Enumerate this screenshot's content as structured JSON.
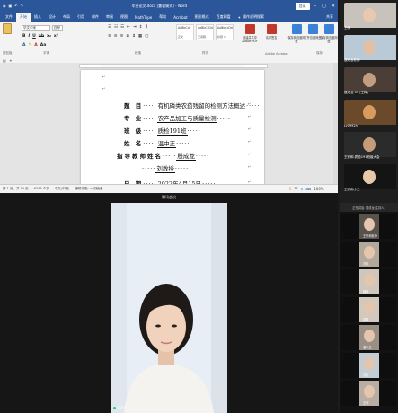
{
  "word": {
    "title": "毕业论文.docx [兼容模式] - Word",
    "login_label": "登录",
    "tabs": [
      "文件",
      "开始",
      "插入",
      "设计",
      "布局",
      "引用",
      "邮件",
      "审阅",
      "视图",
      "MathType",
      "帮助",
      "Acrobat",
      "图形格式",
      "百度网盘"
    ],
    "active_tab": "开始",
    "tell_me": "操作说明搜索",
    "share": "共享",
    "ribbon": {
      "clipboard_label": "剪贴板",
      "paste_label": "粘贴",
      "font_name": "华文中宋",
      "font_size": "四号",
      "font_label": "字体",
      "paragraph_label": "段落",
      "styles_label": "样式",
      "styles": [
        {
          "sample": "AaBbCcI",
          "name": "正文"
        },
        {
          "sample": "AaBbCcDd",
          "name": "无间隔"
        },
        {
          "sample": "AaBbCcDd",
          "name": "标题 1"
        }
      ],
      "acrobat_buttons": [
        {
          "label": "创建并共享 Adobe PDF",
          "color": "#c0392b"
        },
        {
          "label": "请求签名",
          "color": "#c0392b"
        }
      ],
      "acrobat_label": "Adobe Acrobat",
      "baidu_buttons": [
        {
          "label": "保存到百度网盘",
          "color": "#3b82d6"
        },
        {
          "label": "打开百度网盘",
          "color": "#3b82d6"
        },
        {
          "label": "保存到百度网盘",
          "color": "#3b82d6"
        }
      ],
      "baidu_label": "保存"
    },
    "document": {
      "lines": [
        {
          "label": "题   目",
          "value": "有机磷类农药残留的检测方法概述",
          "suffix": ""
        },
        {
          "label": "专   业",
          "value": "农产品加工与质量检测",
          "suffix": ""
        },
        {
          "label": "班   级",
          "value": "质检191班",
          "suffix": ""
        },
        {
          "label": "姓   名",
          "value": "温中正",
          "suffix": ""
        },
        {
          "label": "指导教师姓名",
          "value": "殷成龙",
          "suffix": "",
          "dots_before": "·······",
          "dots_after": "········"
        },
        {
          "label": "",
          "value": "刘教授",
          "suffix": "",
          "prefix": "郭鹏"
        },
        {
          "label": "日   期",
          "value": "2022年4月15日",
          "suffix": ""
        }
      ]
    },
    "status": {
      "page": "第 1 页，共 14 页",
      "words": "6343 个字",
      "language": "中文(中国)",
      "accessibility": "辅助功能: 一切就绪",
      "zoom": "100%"
    },
    "page_indicator": "分节符(下一页)"
  },
  "right_top": {
    "tiles": [
      {
        "name": "王梅",
        "bg": "#c7c2bb",
        "face": "#e8c8b0"
      },
      {
        "name": "殷成龙老师",
        "bg": "#b9c9d6",
        "face": "#e2c0a6"
      },
      {
        "name": "殷成龙 01 (王梅)",
        "bg": "#4a3e36",
        "face": "#c39d82"
      },
      {
        "name": "Ly1992h",
        "bg": "#6a4a2a",
        "face": "#d89b5e"
      },
      {
        "name": "王家和-质检191班级大会",
        "bg": "#2b2b2b",
        "face": "#c59c7a"
      },
      {
        "name": "王家雨小王",
        "bg": "#141414",
        "face": "#e7c9a9"
      }
    ]
  },
  "meeting": {
    "header": "腾讯会议",
    "speaker_name": "温中正",
    "right_header": "正在讲话: 殷成龙(主持人)",
    "participants": [
      {
        "name": "王家和老师",
        "bg": "#58524c"
      },
      {
        "name": "刘晓",
        "bg": "#b3a89c"
      },
      {
        "name": "魏佳",
        "bg": "#cfc6bc"
      },
      {
        "name": "郭鹏",
        "bg": "#d2c8bd"
      },
      {
        "name": "温中正",
        "bg": "#9a8f85"
      },
      {
        "name": "刘远",
        "bg": "#c3cbd3"
      },
      {
        "name": "王明",
        "bg": "#b8aea4"
      }
    ]
  }
}
